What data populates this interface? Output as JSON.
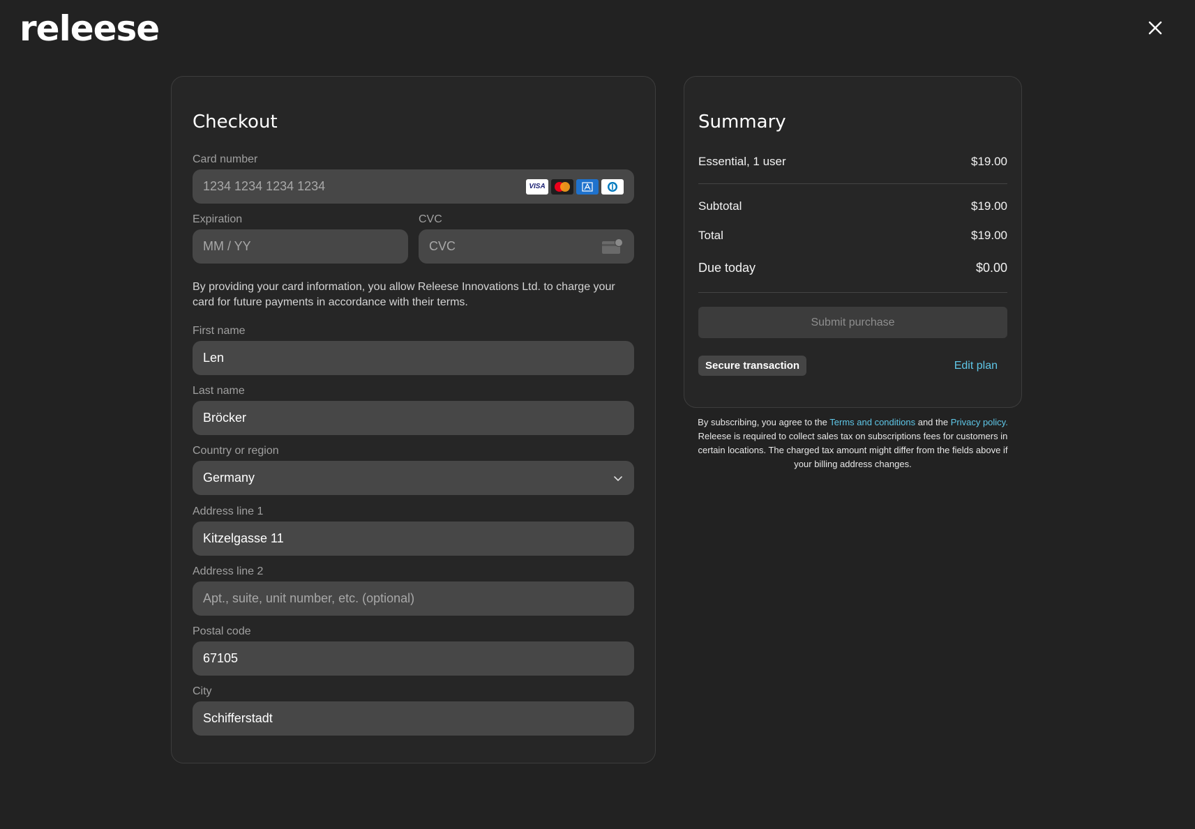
{
  "brand": {
    "logo_text": "releese"
  },
  "checkout": {
    "title": "Checkout",
    "card_number": {
      "label": "Card number",
      "placeholder": "1234 1234 1234 1234",
      "brands": [
        "VISA",
        "mastercard-icon",
        "amex-icon",
        "diners-icon"
      ]
    },
    "expiration": {
      "label": "Expiration",
      "placeholder": "MM / YY"
    },
    "cvc": {
      "label": "CVC",
      "placeholder": "CVC"
    },
    "consent_text": "By providing your card information, you allow Releese Innovations Ltd. to charge your card for future payments in accordance with their terms.",
    "first_name": {
      "label": "First name",
      "value": "Len"
    },
    "last_name": {
      "label": "Last name",
      "value": "Bröcker"
    },
    "country": {
      "label": "Country or region",
      "value": "Germany"
    },
    "address1": {
      "label": "Address line 1",
      "value": "Kitzelgasse 11"
    },
    "address2": {
      "label": "Address line 2",
      "placeholder": "Apt., suite, unit number, etc. (optional)"
    },
    "postal": {
      "label": "Postal code",
      "value": "67105"
    },
    "city": {
      "label": "City",
      "value": "Schifferstadt"
    }
  },
  "summary": {
    "title": "Summary",
    "plan": {
      "label": "Essential, 1 user",
      "amount": "$19.00"
    },
    "subtotal": {
      "label": "Subtotal",
      "amount": "$19.00"
    },
    "total": {
      "label": "Total",
      "amount": "$19.00"
    },
    "due": {
      "label": "Due today",
      "amount": "$0.00"
    },
    "submit_label": "Submit purchase",
    "secure_label": "Secure transaction",
    "edit_label": "Edit plan"
  },
  "legal": {
    "pre": "By subscribing, you agree to the ",
    "terms": "Terms and conditions",
    "mid": " and the ",
    "privacy": "Privacy policy.",
    "post": " Releese is required to collect sales tax on subscriptions fees for customers in certain locations. The charged tax amount might differ from the fields above if your billing address changes."
  },
  "colors": {
    "background": "#222222",
    "field": "#474747",
    "link": "#5fc7e8"
  }
}
